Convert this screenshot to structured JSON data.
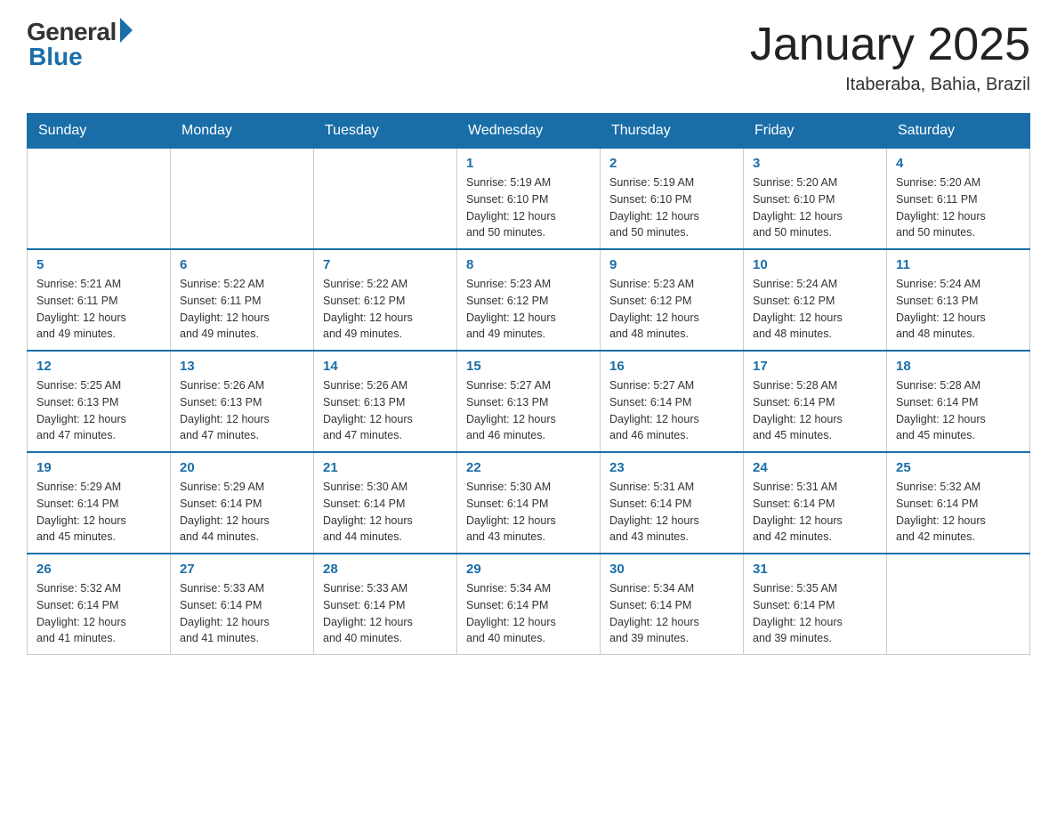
{
  "header": {
    "logo_general": "General",
    "logo_blue": "Blue",
    "title": "January 2025",
    "location": "Itaberaba, Bahia, Brazil"
  },
  "days_of_week": [
    "Sunday",
    "Monday",
    "Tuesday",
    "Wednesday",
    "Thursday",
    "Friday",
    "Saturday"
  ],
  "weeks": [
    [
      {
        "day": "",
        "info": ""
      },
      {
        "day": "",
        "info": ""
      },
      {
        "day": "",
        "info": ""
      },
      {
        "day": "1",
        "info": "Sunrise: 5:19 AM\nSunset: 6:10 PM\nDaylight: 12 hours\nand 50 minutes."
      },
      {
        "day": "2",
        "info": "Sunrise: 5:19 AM\nSunset: 6:10 PM\nDaylight: 12 hours\nand 50 minutes."
      },
      {
        "day": "3",
        "info": "Sunrise: 5:20 AM\nSunset: 6:10 PM\nDaylight: 12 hours\nand 50 minutes."
      },
      {
        "day": "4",
        "info": "Sunrise: 5:20 AM\nSunset: 6:11 PM\nDaylight: 12 hours\nand 50 minutes."
      }
    ],
    [
      {
        "day": "5",
        "info": "Sunrise: 5:21 AM\nSunset: 6:11 PM\nDaylight: 12 hours\nand 49 minutes."
      },
      {
        "day": "6",
        "info": "Sunrise: 5:22 AM\nSunset: 6:11 PM\nDaylight: 12 hours\nand 49 minutes."
      },
      {
        "day": "7",
        "info": "Sunrise: 5:22 AM\nSunset: 6:12 PM\nDaylight: 12 hours\nand 49 minutes."
      },
      {
        "day": "8",
        "info": "Sunrise: 5:23 AM\nSunset: 6:12 PM\nDaylight: 12 hours\nand 49 minutes."
      },
      {
        "day": "9",
        "info": "Sunrise: 5:23 AM\nSunset: 6:12 PM\nDaylight: 12 hours\nand 48 minutes."
      },
      {
        "day": "10",
        "info": "Sunrise: 5:24 AM\nSunset: 6:12 PM\nDaylight: 12 hours\nand 48 minutes."
      },
      {
        "day": "11",
        "info": "Sunrise: 5:24 AM\nSunset: 6:13 PM\nDaylight: 12 hours\nand 48 minutes."
      }
    ],
    [
      {
        "day": "12",
        "info": "Sunrise: 5:25 AM\nSunset: 6:13 PM\nDaylight: 12 hours\nand 47 minutes."
      },
      {
        "day": "13",
        "info": "Sunrise: 5:26 AM\nSunset: 6:13 PM\nDaylight: 12 hours\nand 47 minutes."
      },
      {
        "day": "14",
        "info": "Sunrise: 5:26 AM\nSunset: 6:13 PM\nDaylight: 12 hours\nand 47 minutes."
      },
      {
        "day": "15",
        "info": "Sunrise: 5:27 AM\nSunset: 6:13 PM\nDaylight: 12 hours\nand 46 minutes."
      },
      {
        "day": "16",
        "info": "Sunrise: 5:27 AM\nSunset: 6:14 PM\nDaylight: 12 hours\nand 46 minutes."
      },
      {
        "day": "17",
        "info": "Sunrise: 5:28 AM\nSunset: 6:14 PM\nDaylight: 12 hours\nand 45 minutes."
      },
      {
        "day": "18",
        "info": "Sunrise: 5:28 AM\nSunset: 6:14 PM\nDaylight: 12 hours\nand 45 minutes."
      }
    ],
    [
      {
        "day": "19",
        "info": "Sunrise: 5:29 AM\nSunset: 6:14 PM\nDaylight: 12 hours\nand 45 minutes."
      },
      {
        "day": "20",
        "info": "Sunrise: 5:29 AM\nSunset: 6:14 PM\nDaylight: 12 hours\nand 44 minutes."
      },
      {
        "day": "21",
        "info": "Sunrise: 5:30 AM\nSunset: 6:14 PM\nDaylight: 12 hours\nand 44 minutes."
      },
      {
        "day": "22",
        "info": "Sunrise: 5:30 AM\nSunset: 6:14 PM\nDaylight: 12 hours\nand 43 minutes."
      },
      {
        "day": "23",
        "info": "Sunrise: 5:31 AM\nSunset: 6:14 PM\nDaylight: 12 hours\nand 43 minutes."
      },
      {
        "day": "24",
        "info": "Sunrise: 5:31 AM\nSunset: 6:14 PM\nDaylight: 12 hours\nand 42 minutes."
      },
      {
        "day": "25",
        "info": "Sunrise: 5:32 AM\nSunset: 6:14 PM\nDaylight: 12 hours\nand 42 minutes."
      }
    ],
    [
      {
        "day": "26",
        "info": "Sunrise: 5:32 AM\nSunset: 6:14 PM\nDaylight: 12 hours\nand 41 minutes."
      },
      {
        "day": "27",
        "info": "Sunrise: 5:33 AM\nSunset: 6:14 PM\nDaylight: 12 hours\nand 41 minutes."
      },
      {
        "day": "28",
        "info": "Sunrise: 5:33 AM\nSunset: 6:14 PM\nDaylight: 12 hours\nand 40 minutes."
      },
      {
        "day": "29",
        "info": "Sunrise: 5:34 AM\nSunset: 6:14 PM\nDaylight: 12 hours\nand 40 minutes."
      },
      {
        "day": "30",
        "info": "Sunrise: 5:34 AM\nSunset: 6:14 PM\nDaylight: 12 hours\nand 39 minutes."
      },
      {
        "day": "31",
        "info": "Sunrise: 5:35 AM\nSunset: 6:14 PM\nDaylight: 12 hours\nand 39 minutes."
      },
      {
        "day": "",
        "info": ""
      }
    ]
  ]
}
